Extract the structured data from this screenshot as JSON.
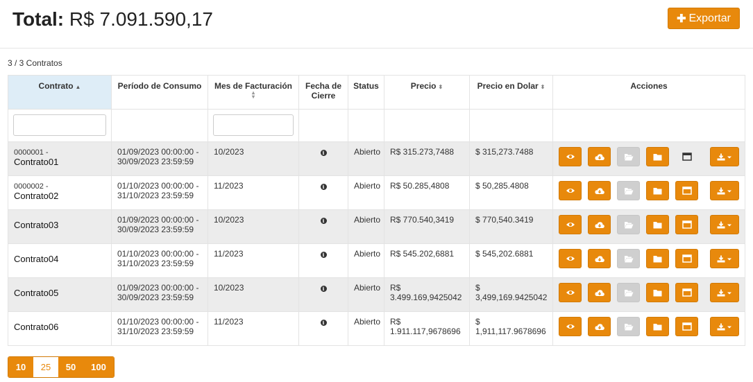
{
  "header": {
    "total_label": "Total:",
    "total_value": "R$ 7.091.590,17",
    "export_label": "Exportar"
  },
  "count_text": "3 / 3 Contratos",
  "columns": [
    "Contrato",
    "Período de Consumo",
    "Mes de Facturación",
    "Fecha de Cierre",
    "Status",
    "Precio",
    "Precio en Dolar",
    "Acciones"
  ],
  "rows": [
    {
      "contract_line1": "0000001 -",
      "contract_line2": "Contrato01",
      "period_line1": "01/09/2023 00:00:00 -",
      "period_line2": "30/09/2023 23:59:59",
      "billing_month": "10/2023",
      "status": "Abierto",
      "price": "R$ 315.273,7488",
      "price_usd": "$ 315,273.7488"
    },
    {
      "contract_line1": "0000002 -",
      "contract_line2": "Contrato02",
      "period_line1": "01/10/2023 00:00:00 -",
      "period_line2": "31/10/2023 23:59:59",
      "billing_month": "11/2023",
      "status": "Abierto",
      "price": "R$ 50.285,4808",
      "price_usd": "$ 50,285.4808"
    },
    {
      "contract_line1": "",
      "contract_line2": "Contrato03",
      "period_line1": "01/09/2023 00:00:00 -",
      "period_line2": "30/09/2023 23:59:59",
      "billing_month": "10/2023",
      "status": "Abierto",
      "price": "R$ 770.540,3419",
      "price_usd": "$ 770,540.3419"
    },
    {
      "contract_line1": "",
      "contract_line2": "Contrato04",
      "period_line1": "01/10/2023 00:00:00 -",
      "period_line2": "31/10/2023 23:59:59",
      "billing_month": "11/2023",
      "status": "Abierto",
      "price": "R$ 545.202,6881",
      "price_usd": "$ 545,202.6881"
    },
    {
      "contract_line1": "",
      "contract_line2": "Contrato05",
      "period_line1": "01/09/2023 00:00:00 -",
      "period_line2": "30/09/2023 23:59:59",
      "billing_month": "10/2023",
      "status": "Abierto",
      "price": "R$ 3.499.169,9425042",
      "price_usd": "$ 3,499,169.9425042"
    },
    {
      "contract_line1": "",
      "contract_line2": "Contrato06",
      "period_line1": "01/10/2023 00:00:00 -",
      "period_line2": "31/10/2023 23:59:59",
      "billing_month": "11/2023",
      "status": "Abierto",
      "price": "R$ 1.911.117,9678696",
      "price_usd": "$ 1,911,117.9678696"
    }
  ],
  "pagination": [
    "10",
    "25",
    "50",
    "100"
  ],
  "pagination_active": "25",
  "colors": {
    "accent": "#e8890c",
    "sorted_header": "#deedf7",
    "status": "#8b1a1a",
    "row_alt": "#ececec",
    "disabled": "#cfcfcf"
  },
  "icons": [
    "plus-icon",
    "sort-up-icon",
    "sort-both-icon",
    "info-icon",
    "eye-icon",
    "cloud-download-icon",
    "folder-open-icon",
    "folder-icon",
    "window-icon",
    "download-icon",
    "caret-down-icon"
  ]
}
